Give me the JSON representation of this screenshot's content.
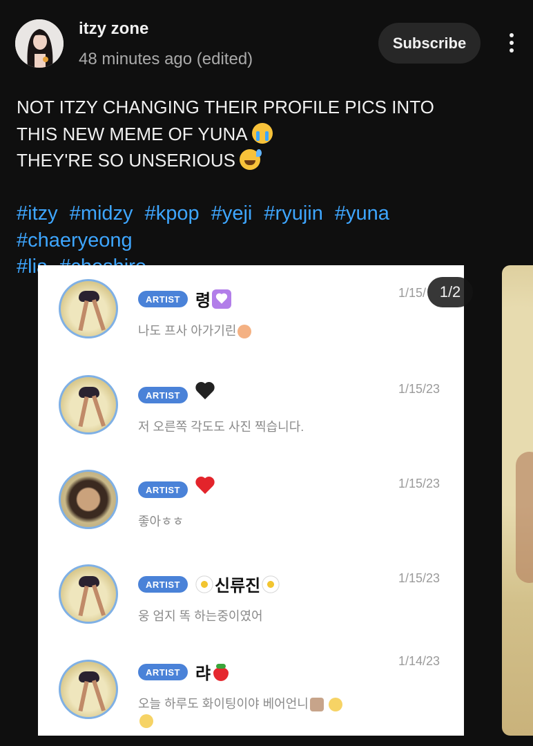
{
  "post": {
    "channel_name": "itzy zone",
    "time": "48 minutes ago (edited)",
    "subscribe_label": "Subscribe",
    "text_lines": [
      "NOT ITZY CHANGING THEIR PROFILE PICS INTO",
      "THIS NEW MEME OF YUNA",
      "THEY'RE SO UNSERIOUS"
    ],
    "hashtags": [
      "#itzy",
      "#midzy",
      "#kpop",
      "#yeji",
      "#ryujin",
      "#yuna",
      "#chaeryeong",
      "#lia",
      "#cheshire"
    ]
  },
  "carousel": {
    "page_indicator": "1/2",
    "comments": [
      {
        "badge": "ARTIST",
        "name": "령",
        "name_emoji": "purple-heart-box",
        "text": "나도 프사 아가기린",
        "date": "1/15/"
      },
      {
        "badge": "ARTIST",
        "name": "",
        "name_emoji": "black-heart",
        "text": "저 오른쪽 각도도 사진 찍습니다.",
        "date": "1/15/23"
      },
      {
        "badge": "ARTIST",
        "name": "",
        "name_emoji": "red-heart",
        "text": "좋아ㅎㅎ",
        "date": "1/15/23"
      },
      {
        "badge": "ARTIST",
        "name": "신류진",
        "name_emoji": "daisy",
        "text": "웅 엄지 똑 하는중이였어",
        "date": "1/15/23"
      },
      {
        "badge": "ARTIST",
        "name": "랴",
        "name_emoji": "strawberry",
        "text": "오늘 하루도 화이팅이야 베어언니",
        "date": "1/14/23"
      }
    ]
  },
  "icons": {
    "more": "more-vertical-icon",
    "crying": "loudly-crying-face-icon",
    "sweat": "grinning-sweat-face-icon"
  },
  "colors": {
    "background": "#0f0f0f",
    "hashtag": "#3ea6ff",
    "artist_badge": "#4a82d8"
  }
}
